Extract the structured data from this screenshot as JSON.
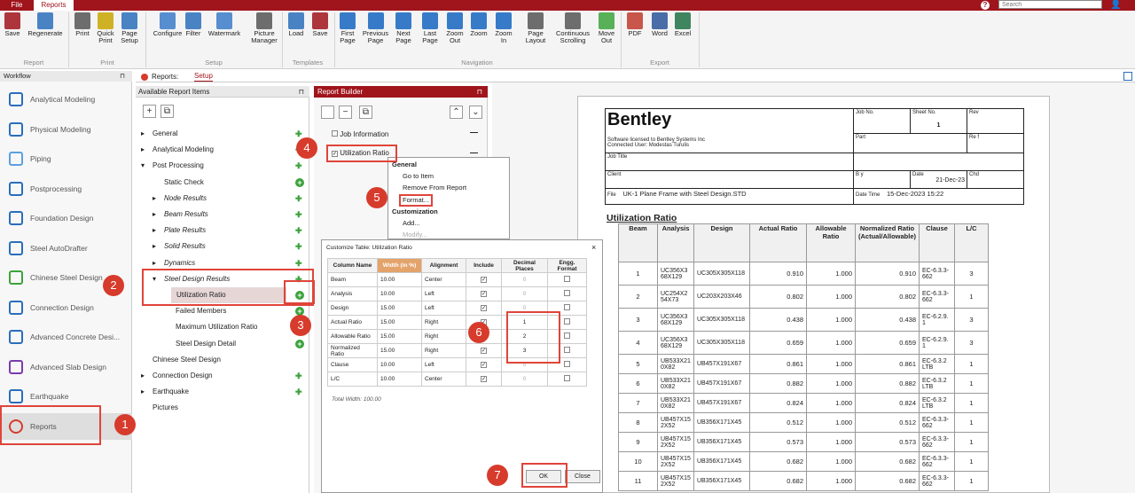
{
  "titlebar": {
    "file": "File",
    "reports": "Reports",
    "search_placeholder": "Search"
  },
  "ribbon": {
    "buttons": [
      "Save",
      "Regenerate",
      "Print",
      "Quick Print",
      "Page Setup",
      "Configure",
      "Filter",
      "Watermark",
      "Picture Manager",
      "Load",
      "Save",
      "First Page",
      "Previous Page",
      "Next Page",
      "Last Page",
      "Zoom Out",
      "Zoom",
      "Zoom In",
      "Page Layout",
      "Continuous Scrolling",
      "Move Out",
      "PDF",
      "Word",
      "Excel"
    ],
    "groups": [
      "Report",
      "Print",
      "Setup",
      "Templates",
      "Navigation",
      "Export"
    ]
  },
  "workflow": {
    "title": "Workflow",
    "items": [
      "Analytical Modeling",
      "Physical Modeling",
      "Piping",
      "Postprocessing",
      "Foundation Design",
      "Steel AutoDrafter",
      "Chinese Steel Design",
      "Connection Design",
      "Advanced Concrete Desi...",
      "Advanced Slab Design",
      "Earthquake",
      "Reports"
    ]
  },
  "tabs": {
    "reports": "Reports:",
    "setup": "Setup"
  },
  "available": {
    "title": "Available Report Items",
    "items": [
      "General",
      "Analytical Modeling",
      "Post Processing",
      "Static Check",
      "Node Results",
      "Beam Results",
      "Plate Results",
      "Solid Results",
      "Dynamics",
      "Steel Design Results",
      "Utilization Ratio",
      "Failed Members",
      "Maximum Utilization Ratio",
      "Steel Design Detail",
      "Chinese Steel Design",
      "Connection Design",
      "Earthquake",
      "Pictures"
    ]
  },
  "builder": {
    "title": "Report Builder",
    "items": [
      "Job Information",
      "Utilization Ratio"
    ]
  },
  "context_menu": {
    "general": "General",
    "goto": "Go to Item",
    "remove": "Remove From Report",
    "format": "Format...",
    "customization": "Customization",
    "add": "Add...",
    "modify": "Modify..."
  },
  "dialog": {
    "title": "Customize Table: Utilization Ratio",
    "headers": [
      "Column Name",
      "Width (in %)",
      "Alignment",
      "Include",
      "Decimal Places",
      "Engg. Format"
    ],
    "rows": [
      [
        "Beam",
        "10.00",
        "Center",
        "✓",
        "0",
        ""
      ],
      [
        "Analysis",
        "10.00",
        "Left",
        "✓",
        "0",
        ""
      ],
      [
        "Design",
        "15.00",
        "Left",
        "✓",
        "0",
        ""
      ],
      [
        "Actual Ratio",
        "15.00",
        "Right",
        "✓",
        "1",
        ""
      ],
      [
        "Allowable Ratio",
        "15.00",
        "Right",
        "✓",
        "2",
        ""
      ],
      [
        "Normalized Ratio",
        "15.00",
        "Right",
        "✓",
        "3",
        ""
      ],
      [
        "Clause",
        "10.00",
        "Left",
        "✓",
        "0",
        ""
      ],
      [
        "L/C",
        "10.00",
        "Center",
        "✓",
        "0",
        ""
      ]
    ],
    "total": "Total Width: 100.00",
    "ok": "OK",
    "close": "Close"
  },
  "preview": {
    "logo": "Bentley",
    "licensed": "Software licensed to Bentley Systems Inc",
    "connected": "Connected User: Modestas Turulis",
    "job_no": "Job No.",
    "sheet_no": "Sheet No.",
    "rev": "Rev",
    "sheet_val": "1",
    "part": "Part",
    "ref": "Re f",
    "job_title": "Job Title",
    "client": "Client",
    "by": "B y",
    "date": "Date",
    "date_val": "21-Dec-23",
    "chd": "Chd",
    "file_label": "File",
    "file": "UK-1 Plane Frame with Steel Design.STD",
    "datetime_label": "Date Time",
    "datetime": "15-Dec-2023 15:22",
    "section_title": "Utilization Ratio",
    "headers": [
      "Beam",
      "Analysis",
      "Design",
      "Actual Ratio",
      "Allowable Ratio",
      "Normalized Ratio (Actual/Allowable)",
      "Clause",
      "L/C"
    ],
    "rows": [
      [
        "1",
        "UC356X368X129",
        "UC305X305X118",
        "0.910",
        "1.000",
        "0.910",
        "EC-6.3.3-662",
        "3"
      ],
      [
        "2",
        "UC254X254X73",
        "UC203X203X46",
        "0.802",
        "1.000",
        "0.802",
        "EC-6.3.3-662",
        "1"
      ],
      [
        "3",
        "UC356X368X129",
        "UC305X305X118",
        "0.438",
        "1.000",
        "0.438",
        "EC-6.2.9.1",
        "3"
      ],
      [
        "4",
        "UC356X368X129",
        "UC305X305X118",
        "0.659",
        "1.000",
        "0.659",
        "EC-6.2.9.1",
        "3"
      ],
      [
        "5",
        "UB533X210X82",
        "UB457X191X67",
        "0.861",
        "1.000",
        "0.861",
        "EC-6.3.2 LTB",
        "1"
      ],
      [
        "6",
        "UB533X210X82",
        "UB457X191X67",
        "0.882",
        "1.000",
        "0.882",
        "EC-6.3.2 LTB",
        "1"
      ],
      [
        "7",
        "UB533X210X82",
        "UB457X191X67",
        "0.824",
        "1.000",
        "0.824",
        "EC-6.3.2 LTB",
        "1"
      ],
      [
        "8",
        "UB457X152X52",
        "UB356X171X45",
        "0.512",
        "1.000",
        "0.512",
        "EC-6.3.3-662",
        "1"
      ],
      [
        "9",
        "UB457X152X52",
        "UB356X171X45",
        "0.573",
        "1.000",
        "0.573",
        "EC-6.3.3-662",
        "1"
      ],
      [
        "10",
        "UB457X152X52",
        "UB356X171X45",
        "0.682",
        "1.000",
        "0.682",
        "EC-6.3.3-662",
        "1"
      ],
      [
        "11",
        "UB457X152X52",
        "UB356X171X45",
        "0.682",
        "1.000",
        "0.682",
        "EC-6.3.3-662",
        "1"
      ]
    ]
  },
  "callouts": [
    "1",
    "2",
    "3",
    "4",
    "5",
    "6",
    "7"
  ],
  "colors": {
    "brand": "#a0141c",
    "callout": "#d73b2c",
    "green": "#3ca33c"
  }
}
